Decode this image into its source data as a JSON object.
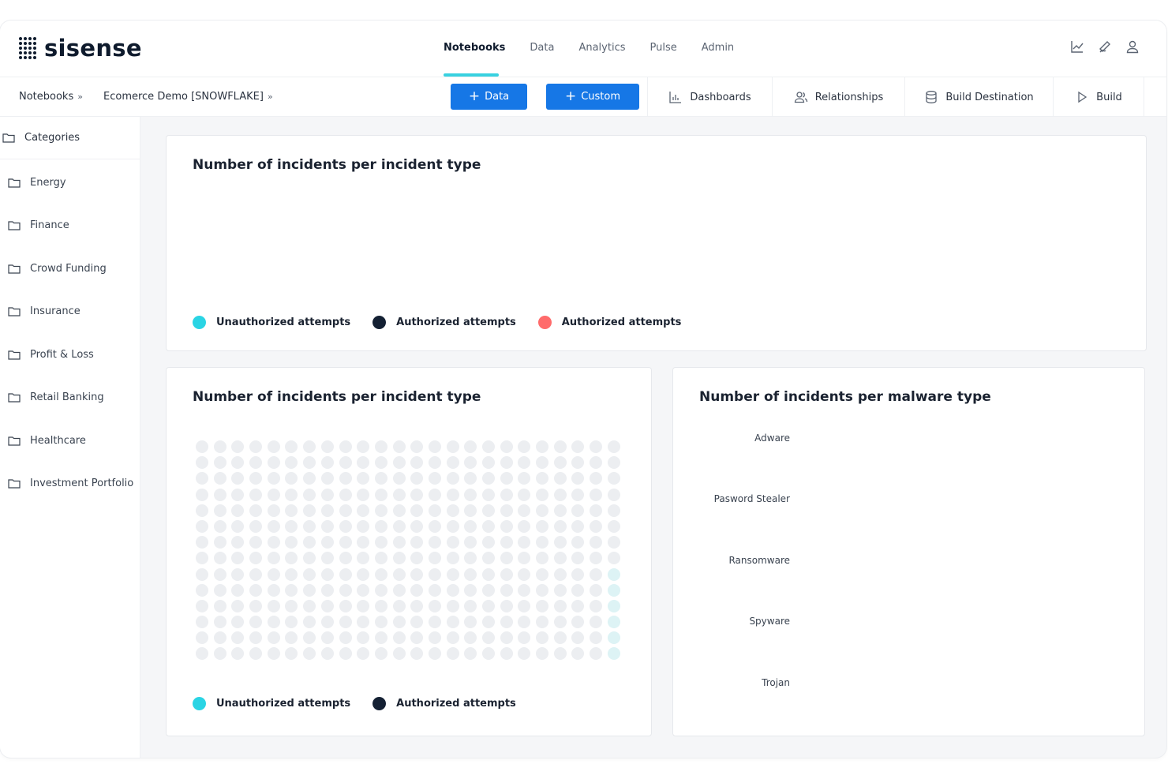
{
  "brand": {
    "name": "sisense"
  },
  "topnav": {
    "items": [
      "Notebooks",
      "Data",
      "Analytics",
      "Pulse",
      "Admin"
    ],
    "active": "Notebooks"
  },
  "header_icons": [
    "line-chart-icon",
    "bell-icon",
    "user-icon"
  ],
  "breadcrumb": {
    "items": [
      "Notebooks",
      "Ecomerce Demo [SNOWFLAKE]"
    ],
    "separator": "»"
  },
  "toolbar": {
    "data_label": "Data",
    "custom_label": "Custom",
    "plus": "+",
    "tabs": [
      {
        "label": "Dashboards",
        "icon": "bar-chart-icon"
      },
      {
        "label": "Relationships",
        "icon": "users-icon"
      },
      {
        "label": "Build Destination",
        "icon": "database-icon"
      },
      {
        "label": "Build",
        "icon": "play-icon"
      }
    ]
  },
  "sidebar": {
    "header": "Categories",
    "items": [
      "Energy",
      "Finance",
      "Crowd Funding",
      "Insurance",
      "Profit & Loss",
      "Retail Banking",
      "Healthcare",
      "Investment Portfolio"
    ]
  },
  "colors": {
    "accent": "#1677e6",
    "unauthorized": "#2ad4e4",
    "authorized_dark": "#142033",
    "authorized_red": "#ff6b6b",
    "nav_underline": "#38d1e0"
  },
  "panels": {
    "top": {
      "title": "Number of incidents per incident type",
      "legend": [
        {
          "label": "Unauthorized attempts",
          "color": "#2ad4e4"
        },
        {
          "label": "Authorized attempts",
          "color": "#142033"
        },
        {
          "label": "Authorized attempts",
          "color": "#ff6b6b"
        }
      ]
    },
    "bottom_left": {
      "title": "Number of incidents per incident type",
      "waffle": {
        "rows": 14,
        "cols": 24,
        "highlighted_last_col_from_row": 8
      },
      "legend": [
        {
          "label": "Unauthorized attempts",
          "color": "#2ad4e4"
        },
        {
          "label": "Authorized attempts",
          "color": "#142033"
        }
      ]
    },
    "bottom_right": {
      "title": "Number of incidents per malware type",
      "categories": [
        "Adware",
        "Pasword Stealer",
        "Ransomware",
        "Spyware",
        "Trojan"
      ]
    }
  }
}
